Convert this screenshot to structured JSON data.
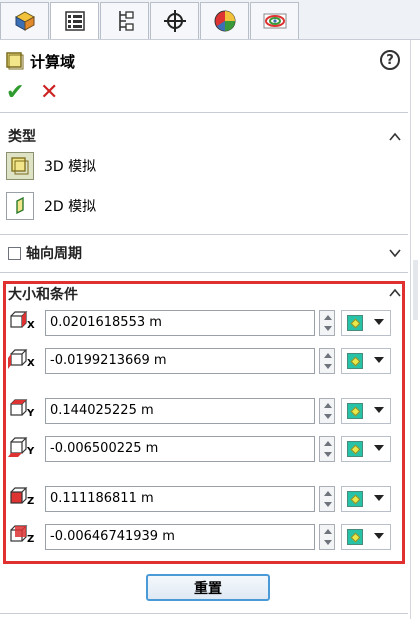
{
  "tabs": [
    {
      "icon": "feature-manager-icon",
      "active": false
    },
    {
      "icon": "property-manager-icon",
      "active": true
    },
    {
      "icon": "configuration-manager-icon",
      "active": false
    },
    {
      "icon": "dimxpert-crosshair-icon",
      "active": false
    },
    {
      "icon": "display-manager-icon",
      "active": false
    },
    {
      "icon": "flow-simulation-icon",
      "active": false
    }
  ],
  "panel": {
    "title": "计算域",
    "help_icon": "?",
    "ok_icon": "✔",
    "cancel_icon": "✕"
  },
  "type_section": {
    "header": "类型",
    "options": [
      {
        "label": "3D 模拟",
        "selected": true
      },
      {
        "label": "2D 模拟",
        "selected": false
      }
    ]
  },
  "axial_periodicity": {
    "label": "轴向周期",
    "checked": false
  },
  "size_section": {
    "header": "大小和条件",
    "params": [
      {
        "axis": "X",
        "value": "0.0201618553 m"
      },
      {
        "axis": "X",
        "value": "-0.0199213669 m"
      },
      {
        "axis": "Y",
        "value": "0.144025225 m"
      },
      {
        "axis": "Y",
        "value": "-0.006500225 m"
      },
      {
        "axis": "Z",
        "value": "0.111186811 m"
      },
      {
        "axis": "Z",
        "value": "-0.00646741939 m"
      }
    ]
  },
  "reset_button": "重置",
  "colors": {
    "highlight": "#e03030",
    "accept": "#2f9b2f",
    "reject": "#cc2222"
  }
}
